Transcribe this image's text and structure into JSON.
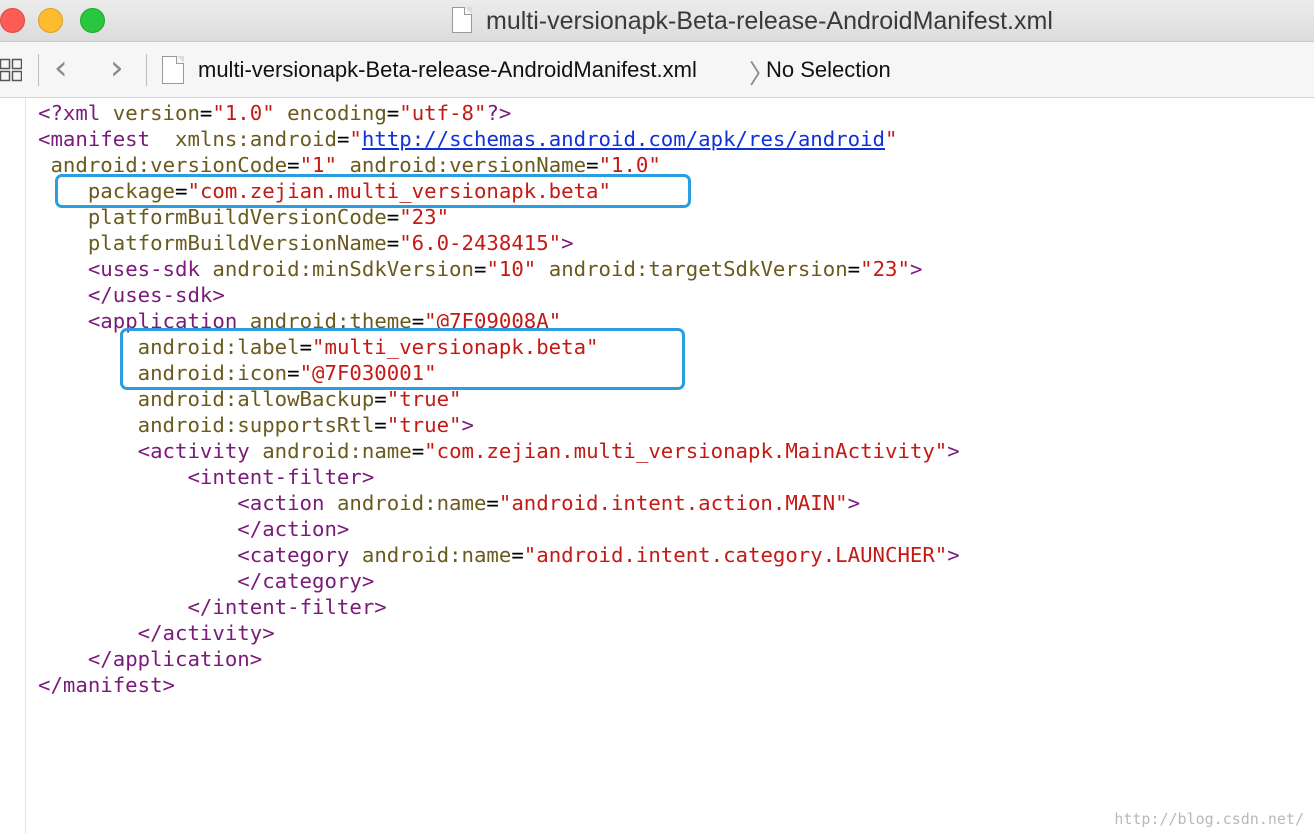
{
  "window": {
    "title": "multi-versionapk-Beta-release-AndroidManifest.xml",
    "controls": [
      "close",
      "minimize",
      "maximize"
    ],
    "icons": {
      "document": "document-icon",
      "grid": "related-items-grid-icon"
    }
  },
  "jumpbar": {
    "back_glyph": "‹",
    "forward_glyph": "›",
    "file_name": "multi-versionapk-Beta-release-AndroidManifest.xml",
    "separator_glyph": "〉",
    "selection": "No Selection"
  },
  "editor": {
    "lines": [
      {
        "indent": "",
        "segments": [
          {
            "t": "tag",
            "v": "<?xml "
          },
          {
            "t": "attr",
            "v": "version"
          },
          {
            "t": "pun",
            "v": "="
          },
          {
            "t": "str",
            "v": "\"1.0\""
          },
          {
            "t": "pun",
            "v": " "
          },
          {
            "t": "attr",
            "v": "encoding"
          },
          {
            "t": "pun",
            "v": "="
          },
          {
            "t": "str",
            "v": "\"utf-8\""
          },
          {
            "t": "tag",
            "v": "?>"
          }
        ]
      },
      {
        "indent": "",
        "segments": [
          {
            "t": "tag",
            "v": "<manifest"
          },
          {
            "t": "pun",
            "v": "  "
          },
          {
            "t": "attr",
            "v": "xmlns:android"
          },
          {
            "t": "pun",
            "v": "="
          },
          {
            "t": "str",
            "v": "\""
          },
          {
            "t": "link",
            "v": "http://schemas.android.com/apk/res/android"
          },
          {
            "t": "str",
            "v": "\""
          }
        ]
      },
      {
        "indent": " ",
        "segments": [
          {
            "t": "attr",
            "v": "android:versionCode"
          },
          {
            "t": "pun",
            "v": "="
          },
          {
            "t": "str",
            "v": "\"1\""
          },
          {
            "t": "pun",
            "v": " "
          },
          {
            "t": "attr",
            "v": "android:versionName"
          },
          {
            "t": "pun",
            "v": "="
          },
          {
            "t": "str",
            "v": "\"1.0\""
          }
        ]
      },
      {
        "indent": "    ",
        "segments": [
          {
            "t": "attr",
            "v": "package"
          },
          {
            "t": "pun",
            "v": "="
          },
          {
            "t": "str",
            "v": "\"com.zejian.multi_versionapk.beta\""
          }
        ]
      },
      {
        "indent": "    ",
        "segments": [
          {
            "t": "attr",
            "v": "platformBuildVersionCode"
          },
          {
            "t": "pun",
            "v": "="
          },
          {
            "t": "str",
            "v": "\"23\""
          }
        ]
      },
      {
        "indent": "    ",
        "segments": [
          {
            "t": "attr",
            "v": "platformBuildVersionName"
          },
          {
            "t": "pun",
            "v": "="
          },
          {
            "t": "str",
            "v": "\"6.0-2438415\""
          },
          {
            "t": "tag",
            "v": ">"
          }
        ]
      },
      {
        "indent": "    ",
        "segments": [
          {
            "t": "tag",
            "v": "<uses-sdk"
          },
          {
            "t": "pun",
            "v": " "
          },
          {
            "t": "attr",
            "v": "android:minSdkVersion"
          },
          {
            "t": "pun",
            "v": "="
          },
          {
            "t": "str",
            "v": "\"10\""
          },
          {
            "t": "pun",
            "v": " "
          },
          {
            "t": "attr",
            "v": "android:targetSdkVersion"
          },
          {
            "t": "pun",
            "v": "="
          },
          {
            "t": "str",
            "v": "\"23\""
          },
          {
            "t": "tag",
            "v": ">"
          }
        ]
      },
      {
        "indent": "    ",
        "segments": [
          {
            "t": "tag",
            "v": "</uses-sdk>"
          }
        ]
      },
      {
        "indent": "    ",
        "segments": [
          {
            "t": "tag",
            "v": "<application"
          },
          {
            "t": "pun",
            "v": " "
          },
          {
            "t": "attr",
            "v": "android:theme"
          },
          {
            "t": "pun",
            "v": "="
          },
          {
            "t": "str",
            "v": "\"@7F09008A\""
          }
        ]
      },
      {
        "indent": "        ",
        "segments": [
          {
            "t": "attr",
            "v": "android:label"
          },
          {
            "t": "pun",
            "v": "="
          },
          {
            "t": "str",
            "v": "\"multi_versionapk.beta\""
          }
        ]
      },
      {
        "indent": "        ",
        "segments": [
          {
            "t": "attr",
            "v": "android:icon"
          },
          {
            "t": "pun",
            "v": "="
          },
          {
            "t": "str",
            "v": "\"@7F030001\""
          }
        ]
      },
      {
        "indent": "        ",
        "segments": [
          {
            "t": "attr",
            "v": "android:allowBackup"
          },
          {
            "t": "pun",
            "v": "="
          },
          {
            "t": "str",
            "v": "\"true\""
          }
        ]
      },
      {
        "indent": "        ",
        "segments": [
          {
            "t": "attr",
            "v": "android:supportsRtl"
          },
          {
            "t": "pun",
            "v": "="
          },
          {
            "t": "str",
            "v": "\"true\""
          },
          {
            "t": "tag",
            "v": ">"
          }
        ]
      },
      {
        "indent": "        ",
        "segments": [
          {
            "t": "tag",
            "v": "<activity"
          },
          {
            "t": "pun",
            "v": " "
          },
          {
            "t": "attr",
            "v": "android:name"
          },
          {
            "t": "pun",
            "v": "="
          },
          {
            "t": "str",
            "v": "\"com.zejian.multi_versionapk.MainActivity\""
          },
          {
            "t": "tag",
            "v": ">"
          }
        ]
      },
      {
        "indent": "            ",
        "segments": [
          {
            "t": "tag",
            "v": "<intent-filter>"
          }
        ]
      },
      {
        "indent": "                ",
        "segments": [
          {
            "t": "tag",
            "v": "<action"
          },
          {
            "t": "pun",
            "v": " "
          },
          {
            "t": "attr",
            "v": "android:name"
          },
          {
            "t": "pun",
            "v": "="
          },
          {
            "t": "str",
            "v": "\"android.intent.action.MAIN\""
          },
          {
            "t": "tag",
            "v": ">"
          }
        ]
      },
      {
        "indent": "                ",
        "segments": [
          {
            "t": "tag",
            "v": "</action>"
          }
        ]
      },
      {
        "indent": "                ",
        "segments": [
          {
            "t": "tag",
            "v": "<category"
          },
          {
            "t": "pun",
            "v": " "
          },
          {
            "t": "attr",
            "v": "android:name"
          },
          {
            "t": "pun",
            "v": "="
          },
          {
            "t": "str",
            "v": "\"android.intent.category.LAUNCHER\""
          },
          {
            "t": "tag",
            "v": ">"
          }
        ]
      },
      {
        "indent": "                ",
        "segments": [
          {
            "t": "tag",
            "v": "</category>"
          }
        ]
      },
      {
        "indent": "            ",
        "segments": [
          {
            "t": "tag",
            "v": "</intent-filter>"
          }
        ]
      },
      {
        "indent": "        ",
        "segments": [
          {
            "t": "tag",
            "v": "</activity>"
          }
        ]
      },
      {
        "indent": "    ",
        "segments": [
          {
            "t": "tag",
            "v": "</application>"
          }
        ]
      },
      {
        "indent": "",
        "segments": [
          {
            "t": "tag",
            "v": "</manifest>"
          }
        ]
      }
    ]
  },
  "highlight": {
    "color": "#2a9ee0"
  },
  "colors": {
    "tag": "#7a1a7a",
    "attribute": "#6a5a1e",
    "string": "#c41a16",
    "link": "#1030d8"
  },
  "watermark": "http://blog.csdn.net/"
}
